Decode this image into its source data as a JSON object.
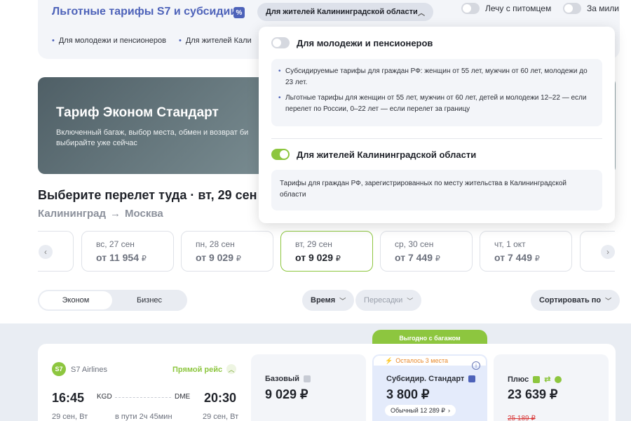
{
  "top": {
    "title": "Льготные тарифы S7 и субсидии",
    "pct": "%",
    "region_pill": "Для жителей Калининградской области",
    "links": [
      "Для молодежи и пенсионеров",
      "Для жителей Кали"
    ],
    "pet_label": "Лечу с питомцем",
    "miles_label": "За мили"
  },
  "banner": {
    "title": "Тариф Эконом Стандарт",
    "desc": "Включенный багаж, выбор места, обмен и возврат би выбирайте уже сейчас"
  },
  "route": {
    "title": "Выберите перелет туда · вт, 29 сен",
    "from": "Калининград",
    "arrow": "→",
    "to": "Москва"
  },
  "dates": [
    {
      "day": "вс, 27 сен",
      "price": "от 11 954",
      "cur": "₽"
    },
    {
      "day": "пн, 28 сен",
      "price": "от 9 029",
      "cur": "₽"
    },
    {
      "day": "вт, 29 сен",
      "price": "от 9 029",
      "cur": "₽"
    },
    {
      "day": "ср, 30 сен",
      "price": "от 7 449",
      "cur": "₽"
    },
    {
      "day": "чт, 1 окт",
      "price": "от 7 449",
      "cur": "₽"
    }
  ],
  "filters": {
    "class_economy": "Эконом",
    "class_business": "Бизнес",
    "time": "Время",
    "transfers": "Пересадки",
    "sort": "Сортировать по"
  },
  "flight": {
    "airline": "S7 Airlines",
    "logo_text": "S7",
    "direct": "Прямой рейс",
    "dep_time": "16:45",
    "dep_code": "KGD",
    "arr_code": "DME",
    "arr_time": "20:30",
    "dep_date": "29 сен, Вт",
    "duration": "в пути 2ч 45мин",
    "arr_date": "29 сен, Вт",
    "bag_badge": "Выгодно с багажом",
    "fares": {
      "base_name": "Базовый",
      "base_price": "9 029 ₽",
      "sub_left": "Осталось 3 места",
      "sub_name": "Субсидир. Стандарт",
      "sub_price": "3 800 ₽",
      "sub_usual": "Обычный 12 289 ₽",
      "plus_name": "Плюс",
      "plus_price": "23 639 ₽",
      "plus_old": "25 189 ₽"
    }
  },
  "dropdown": {
    "youth_title": "Для молодежи и пенсионеров",
    "youth_items": [
      "Субсидируемые тарифы для граждан РФ: женщин от 55 лет, мужчин от 60 лет, молодежи до 23 лет.",
      "Льготные тарифы для женщин от 55 лет, мужчин от 60 лет, детей и молодежи 12–22 — если перелет по России, 0–22 лет — если перелет за границу"
    ],
    "kgd_title": "Для жителей Калининградской области",
    "kgd_text": "Тарифы для граждан РФ, зарегистрированных по месту жительства в Калининградской области"
  },
  "colors": {
    "accent": "#4d62b9",
    "green": "#8dc63f",
    "warning": "#e8892b",
    "old_price": "#d93a3a"
  }
}
